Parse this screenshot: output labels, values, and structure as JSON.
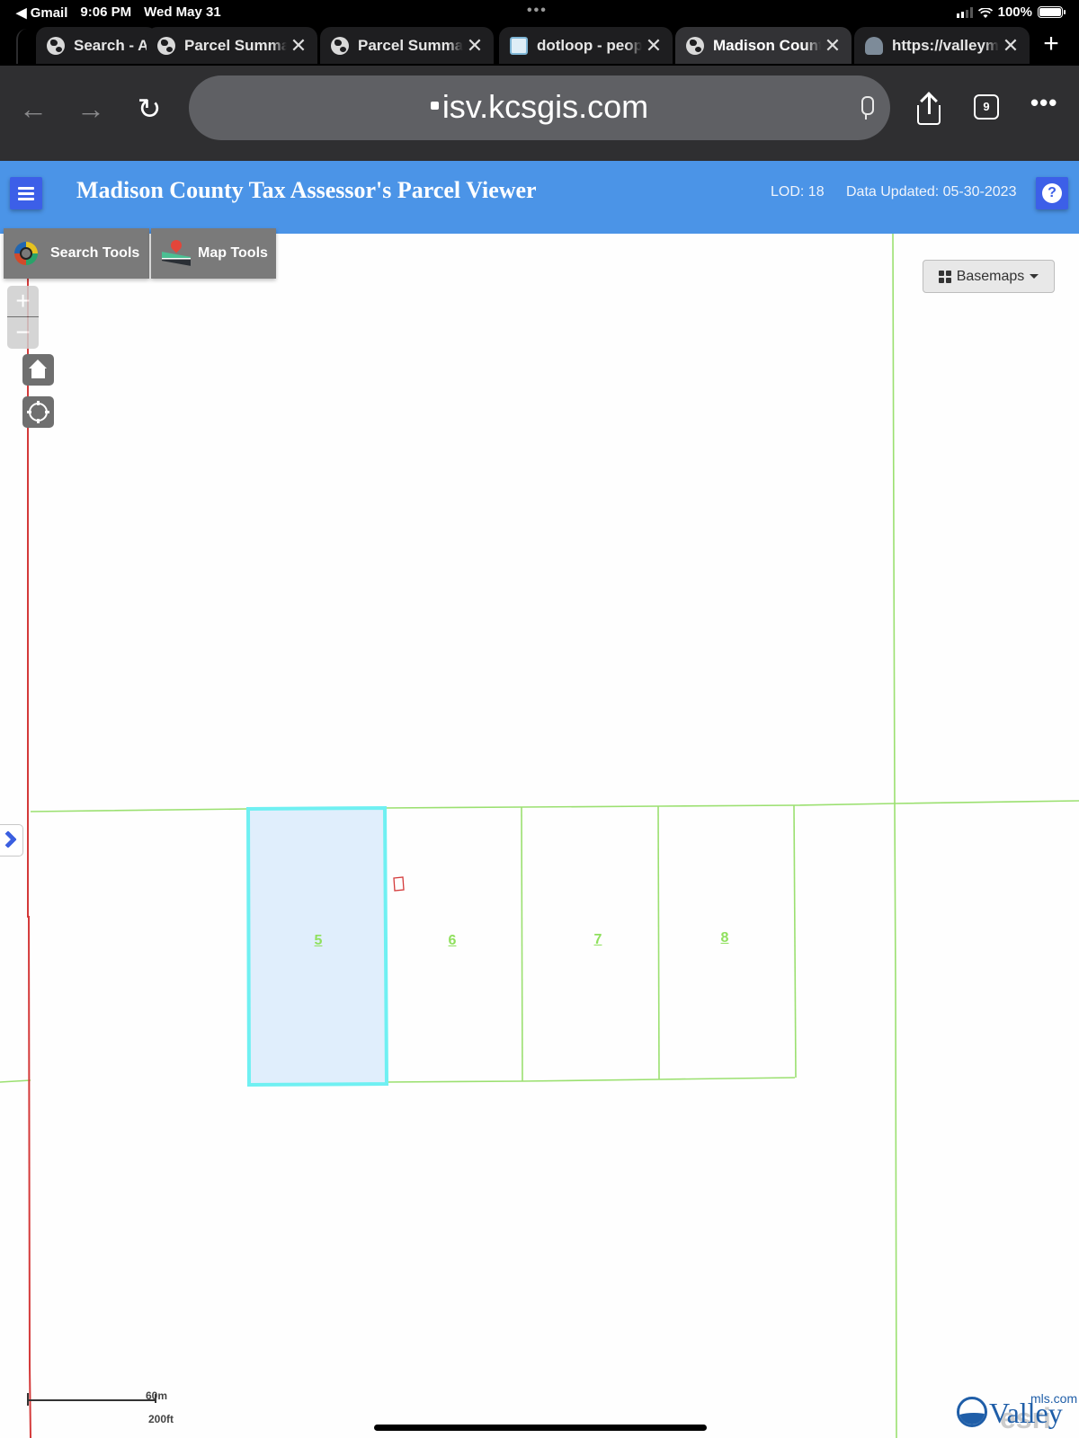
{
  "status_bar": {
    "back_app": "◀ Gmail",
    "time": "9:06 PM",
    "date": "Wed May 31",
    "multitask_dots": "•••",
    "battery": "100%"
  },
  "tabs": [
    {
      "title": "Search - A",
      "icon": "globe-icon",
      "active": false,
      "has_close": false
    },
    {
      "title": "Parcel Summa",
      "icon": "globe-icon",
      "active": false,
      "has_close": true
    },
    {
      "title": "Parcel Summa",
      "icon": "globe-icon",
      "active": false,
      "has_close": true
    },
    {
      "title": "dotloop - peop",
      "icon": "dotloop-icon",
      "active": false,
      "has_close": true
    },
    {
      "title": "Madison Count",
      "icon": "globe-icon",
      "active": true,
      "has_close": true
    },
    {
      "title": "https://valleym",
      "icon": "valley-icon",
      "active": false,
      "has_close": true
    }
  ],
  "tab_close_glyph": "✕",
  "new_tab_glyph": "+",
  "toolbar": {
    "back_glyph": "←",
    "forward_glyph": "→",
    "reload_glyph": "↻",
    "url": "isv.kcsgis.com",
    "tab_count": "9",
    "more_glyph": "•••"
  },
  "app": {
    "title": "Madison County Tax Assessor's Parcel Viewer",
    "lod": "LOD: 18",
    "data_updated": "Data Updated: 05-30-2023",
    "help_glyph": "?",
    "accent_color": "#4b94e7",
    "button_color": "#3c5fe8"
  },
  "map_tools": {
    "search_tools_label": "Search Tools",
    "map_tools_label": "Map Tools",
    "zoom_in_glyph": "+",
    "zoom_out_glyph": "−",
    "basemaps_label": "Basemaps"
  },
  "map": {
    "lots": [
      {
        "label": "5",
        "selected": true
      },
      {
        "label": "6",
        "selected": false
      },
      {
        "label": "7",
        "selected": false
      },
      {
        "label": "8",
        "selected": false
      }
    ],
    "parcel_line_color": "#9be070",
    "selected_outline_color": "#6ff0f2",
    "selected_fill_color": "#e0eefc",
    "road_line_color": "#d43a3a"
  },
  "scale": {
    "metric": "60m",
    "imperial": "200ft"
  },
  "attribution": {
    "logo_word": "Valley",
    "logo_suffix": "mls.com",
    "watermark": "esri"
  }
}
